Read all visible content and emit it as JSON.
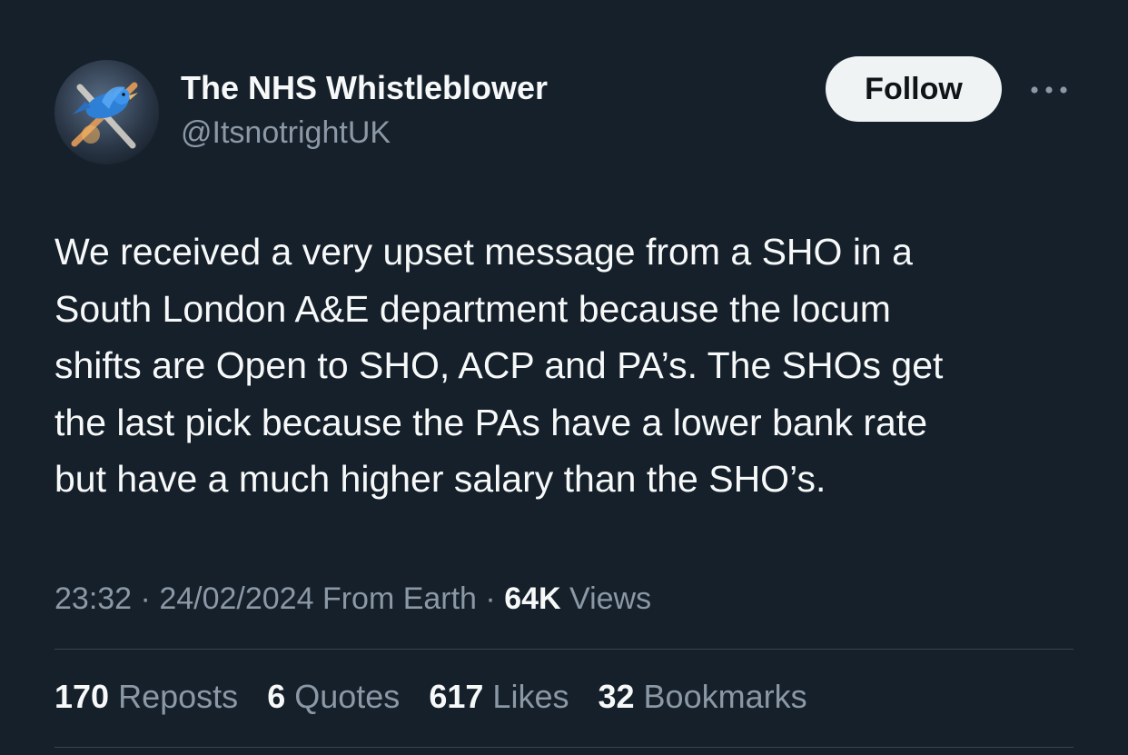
{
  "author": {
    "display_name": "The NHS Whistleblower",
    "handle": "@ItsnotrightUK",
    "avatar_icon": "blue-bird-x-avatar"
  },
  "actions": {
    "follow_label": "Follow",
    "more_icon": "more-dots-icon"
  },
  "tweet": {
    "lines": [
      "We received a very upset message from a SHO in a",
      "South London A&E department because the locum",
      "shifts are Open to SHO, ACP and PA’s. The SHOs get",
      "the last pick because the PAs have a lower bank rate",
      "but have a much higher salary than the SHO’s."
    ]
  },
  "meta": {
    "time": "23:32",
    "separator": " · ",
    "date": "24/02/2024",
    "source": "From Earth",
    "views_count": "64K",
    "views_label": "Views"
  },
  "stats": {
    "reposts_count": "170",
    "reposts_label": "Reposts",
    "quotes_count": "6",
    "quotes_label": "Quotes",
    "likes_count": "617",
    "likes_label": "Likes",
    "bookmarks_count": "32",
    "bookmarks_label": "Bookmarks"
  },
  "colors": {
    "background": "#15202b",
    "text_primary": "#f7f9f9",
    "text_secondary": "#8b98a5",
    "divider": "#38444d",
    "button_bg": "#eff3f4"
  }
}
